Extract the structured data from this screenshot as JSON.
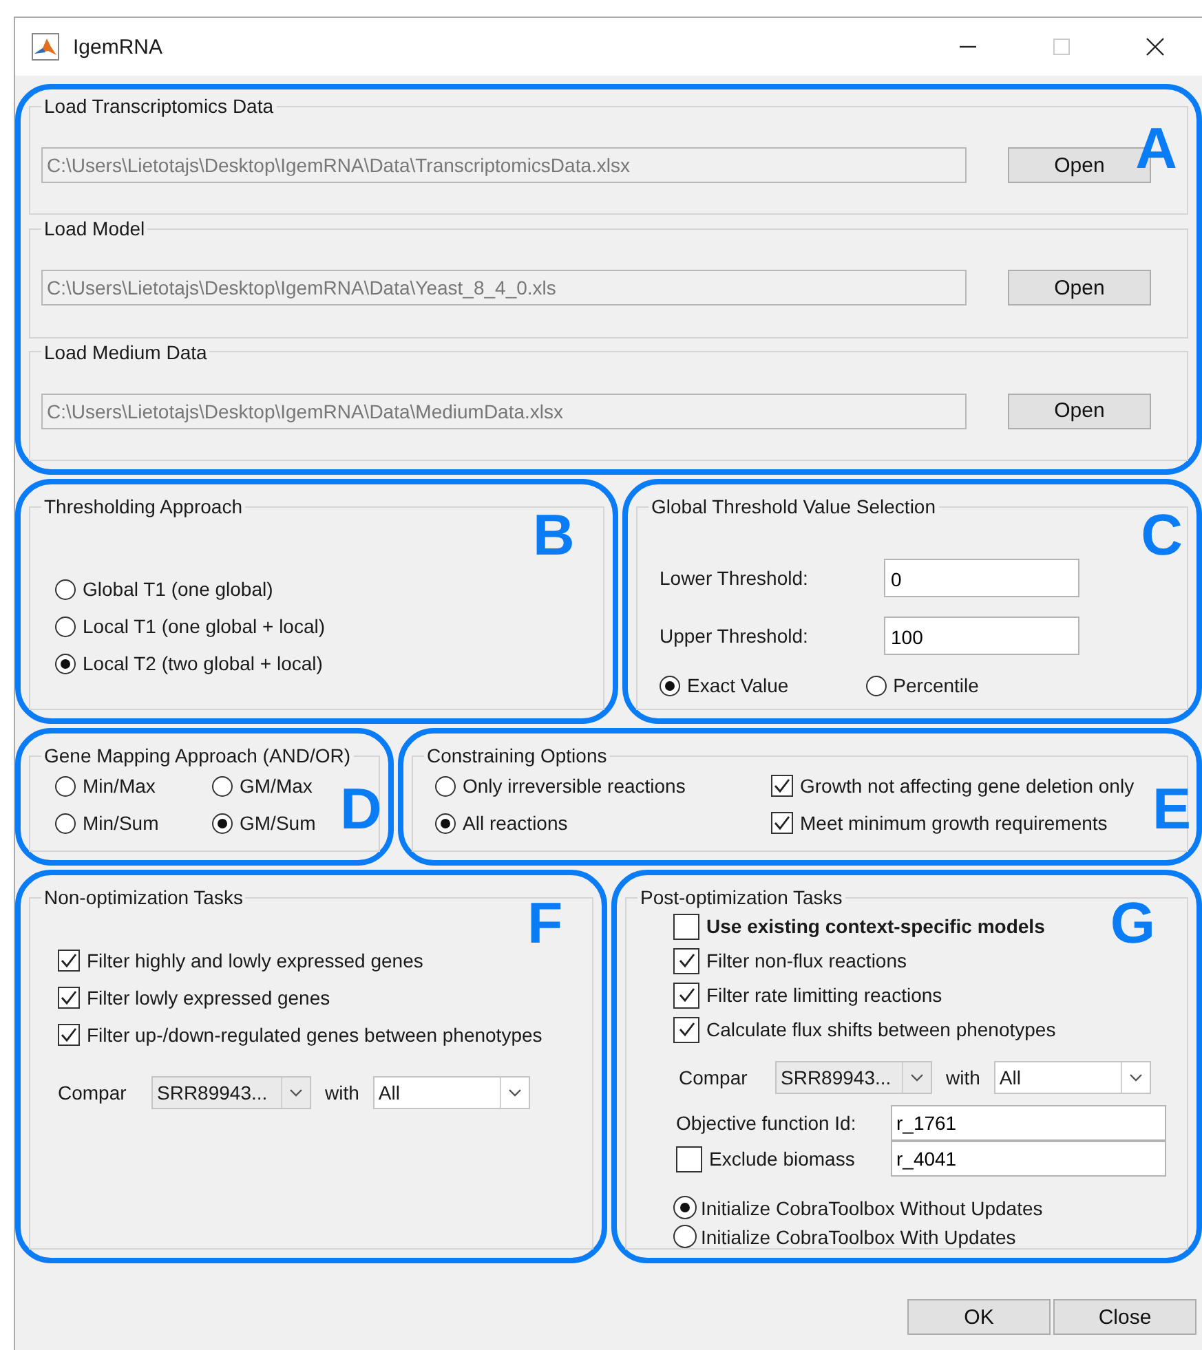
{
  "window": {
    "title": "IgemRNA"
  },
  "load_section": {
    "marker": "A",
    "panels": [
      {
        "title": "Load Transcriptomics Data",
        "path": "C:\\Users\\Lietotajs\\Desktop\\IgemRNA\\Data\\TranscriptomicsData.xlsx",
        "button": "Open"
      },
      {
        "title": "Load Model",
        "path": "C:\\Users\\Lietotajs\\Desktop\\IgemRNA\\Data\\Yeast_8_4_0.xls",
        "button": "Open"
      },
      {
        "title": "Load Medium Data",
        "path": "C:\\Users\\Lietotajs\\Desktop\\IgemRNA\\Data\\MediumData.xlsx",
        "button": "Open"
      }
    ]
  },
  "thresholding": {
    "marker": "B",
    "title": "Thresholding Approach",
    "options": [
      {
        "label": "Global T1 (one global)",
        "selected": false
      },
      {
        "label": "Local T1 (one global + local)",
        "selected": false
      },
      {
        "label": "Local T2 (two global + local)",
        "selected": true
      }
    ]
  },
  "global_threshold": {
    "marker": "C",
    "title": "Global Threshold Value Selection",
    "fields": [
      {
        "label": "Lower Threshold:",
        "value": "0"
      },
      {
        "label": "Upper Threshold:",
        "value": "100"
      }
    ],
    "options": [
      {
        "label": "Exact Value",
        "selected": true
      },
      {
        "label": "Percentile",
        "selected": false
      }
    ]
  },
  "gene_mapping": {
    "marker": "D",
    "title": "Gene Mapping Approach (AND/OR)",
    "options": [
      {
        "label": "Min/Max",
        "selected": false
      },
      {
        "label": "GM/Max",
        "selected": false
      },
      {
        "label": "Min/Sum",
        "selected": false
      },
      {
        "label": "GM/Sum",
        "selected": true
      }
    ]
  },
  "constraining": {
    "marker": "E",
    "title": "Constraining Options",
    "options": [
      {
        "label": "Only irreversible reactions",
        "selected": false
      },
      {
        "label": "All reactions",
        "selected": true
      }
    ],
    "checks": [
      {
        "label": "Growth not affecting gene deletion only",
        "checked": true
      },
      {
        "label": "Meet minimum growth requirements",
        "checked": true
      }
    ]
  },
  "non_optimization": {
    "marker": "F",
    "title": "Non-optimization Tasks",
    "checks": [
      {
        "label": "Filter highly and lowly expressed genes",
        "checked": true
      },
      {
        "label": "Filter lowly expressed genes",
        "checked": true
      },
      {
        "label": "Filter up-/down-regulated genes between phenotypes",
        "checked": true
      }
    ],
    "compare": {
      "label": "Compar",
      "first": "SRR89943...",
      "with_label": "with",
      "second": "All"
    }
  },
  "post_optimization": {
    "marker": "G",
    "title": "Post-optimization Tasks",
    "checks": [
      {
        "label": "Use existing context-specific models",
        "checked": false,
        "bold": true
      },
      {
        "label": "Filter non-flux reactions",
        "checked": true,
        "bold": false
      },
      {
        "label": "Filter rate limitting reactions",
        "checked": true,
        "bold": false
      },
      {
        "label": "Calculate flux shifts between phenotypes",
        "checked": true,
        "bold": false
      }
    ],
    "compare": {
      "label": "Compar",
      "first": "SRR89943...",
      "with_label": "with",
      "second": "All"
    },
    "objective": {
      "label": "Objective function Id:",
      "values": [
        "r_1761",
        "r_4041"
      ]
    },
    "exclude": {
      "label": "Exclude biomass",
      "checked": false
    },
    "init_options": [
      {
        "label": "Initialize CobraToolbox Without Updates",
        "selected": true
      },
      {
        "label": "Initialize CobraToolbox With Updates",
        "selected": false
      }
    ]
  },
  "buttons": [
    "OK",
    "Close"
  ]
}
